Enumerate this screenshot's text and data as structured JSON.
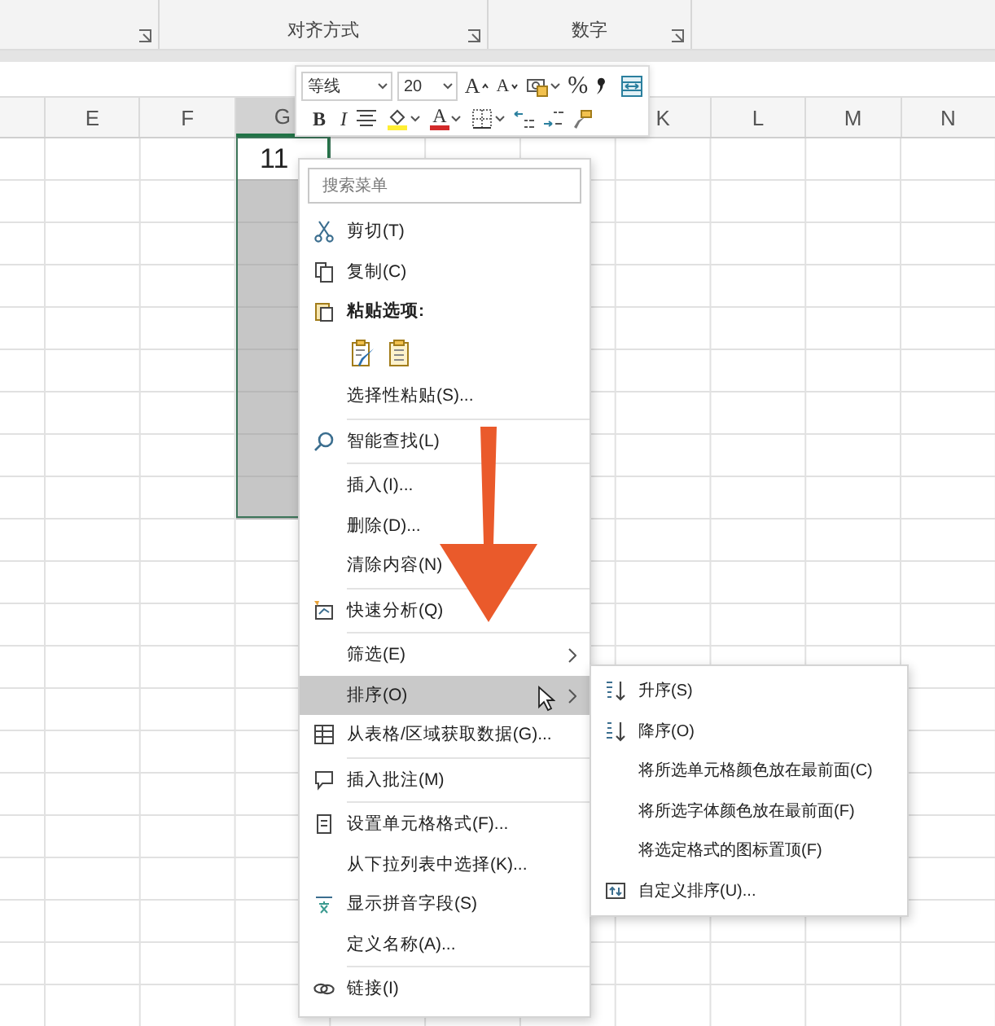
{
  "ribbon": {
    "groups": [
      {
        "label": "对齐方式"
      },
      {
        "label": "数字"
      }
    ]
  },
  "sheet": {
    "columns": [
      {
        "label": "E",
        "selected": false
      },
      {
        "label": "F",
        "selected": false
      },
      {
        "label": "G",
        "selected": true
      },
      {
        "label": "K",
        "selected": false
      },
      {
        "label": "L",
        "selected": false
      },
      {
        "label": "M",
        "selected": false
      },
      {
        "label": "N",
        "selected": false
      }
    ],
    "rows": [
      {
        "active": true,
        "value": "11"
      },
      {
        "selected": true
      },
      {
        "selected": true
      },
      {
        "selected": true
      },
      {
        "selected": true
      },
      {
        "selected": true
      },
      {
        "selected": true
      },
      {
        "selected": true
      },
      {
        "selected": true
      }
    ]
  },
  "mini_toolbar": {
    "font": "等线",
    "size": "20",
    "grow": "A",
    "shrink": "A",
    "percent": "%",
    "bold": "B",
    "italic": "I",
    "font_color": "A"
  },
  "context_menu": {
    "search": {
      "placeholder": "搜索菜单"
    },
    "items": [
      {
        "kind": "item",
        "label": "剪切(T)",
        "submenu": false,
        "selected": false
      },
      {
        "kind": "item",
        "label": "复制(C)",
        "submenu": false,
        "selected": false
      },
      {
        "kind": "header",
        "label": "粘贴选项:"
      },
      {
        "kind": "paste_options"
      },
      {
        "kind": "item",
        "label": "选择性粘贴(S)...",
        "submenu": false,
        "selected": false
      },
      {
        "kind": "separator"
      },
      {
        "kind": "item",
        "label": "智能查找(L)",
        "submenu": false,
        "selected": false
      },
      {
        "kind": "separator"
      },
      {
        "kind": "item",
        "label": "插入(I)...",
        "submenu": false,
        "selected": false
      },
      {
        "kind": "item",
        "label": "删除(D)...",
        "submenu": false,
        "selected": false
      },
      {
        "kind": "item",
        "label": "清除内容(N)",
        "submenu": false,
        "selected": false
      },
      {
        "kind": "separator"
      },
      {
        "kind": "item",
        "label": "快速分析(Q)",
        "submenu": false,
        "selected": false
      },
      {
        "kind": "separator"
      },
      {
        "kind": "item",
        "label": "筛选(E)",
        "submenu": true,
        "selected": false
      },
      {
        "kind": "item",
        "label": "排序(O)",
        "submenu": true,
        "selected": true
      },
      {
        "kind": "item",
        "label": "从表格/区域获取数据(G)...",
        "submenu": false,
        "selected": false
      },
      {
        "kind": "separator"
      },
      {
        "kind": "item",
        "label": "插入批注(M)",
        "submenu": false,
        "selected": false
      },
      {
        "kind": "separator"
      },
      {
        "kind": "item",
        "label": "设置单元格格式(F)...",
        "submenu": false,
        "selected": false
      },
      {
        "kind": "item",
        "label": "从下拉列表中选择(K)...",
        "submenu": false,
        "selected": false
      },
      {
        "kind": "item",
        "label": "显示拼音字段(S)",
        "submenu": false,
        "selected": false
      },
      {
        "kind": "item",
        "label": "定义名称(A)...",
        "submenu": false,
        "selected": false
      },
      {
        "kind": "separator"
      },
      {
        "kind": "item",
        "label": "链接(I)",
        "submenu": false,
        "selected": false
      }
    ]
  },
  "submenu": {
    "items": [
      {
        "label": "升序(S)"
      },
      {
        "label": "降序(O)"
      },
      {
        "label": "将所选单元格颜色放在最前面(C)"
      },
      {
        "label": "将所选字体颜色放在最前面(F)"
      },
      {
        "label": "将选定格式的图标置顶(F)"
      },
      {
        "label": "自定义排序(U)..."
      }
    ]
  }
}
